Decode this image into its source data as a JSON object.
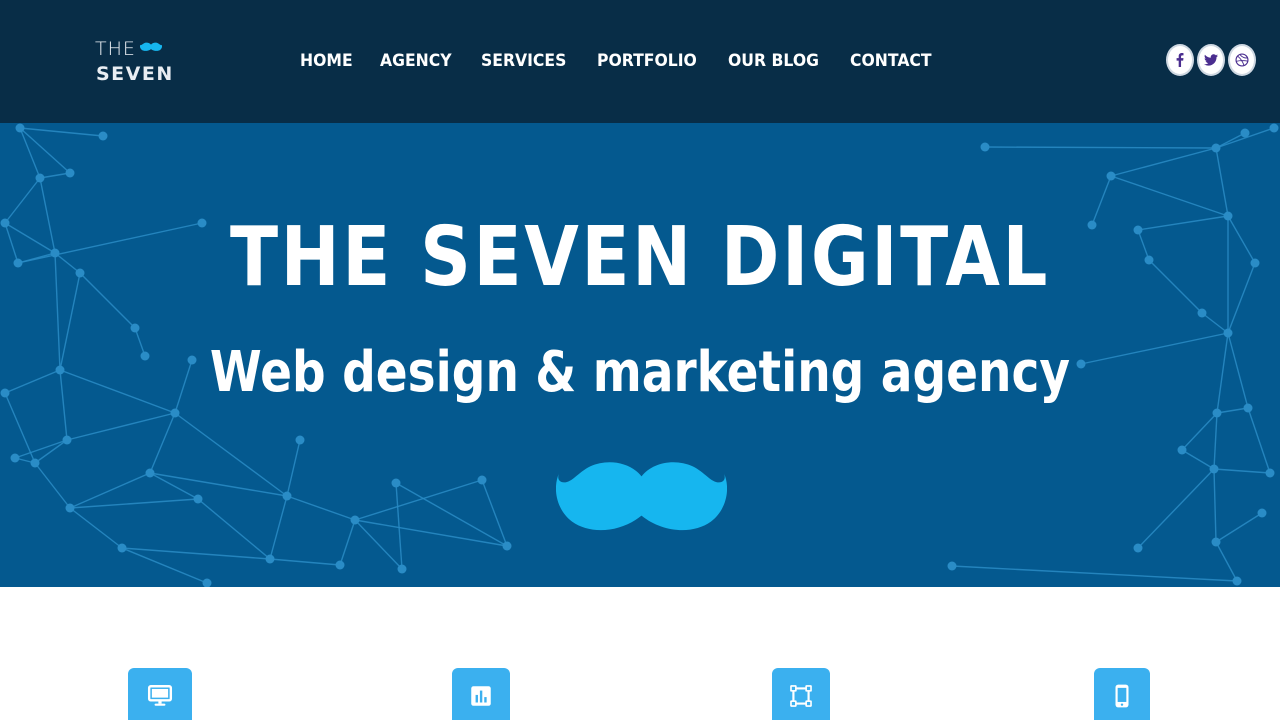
{
  "brand": {
    "line1": "THE",
    "line2": "SEVEN",
    "logo_icon": "mustache-icon"
  },
  "nav": {
    "items": [
      {
        "label": "HOME"
      },
      {
        "label": "AGENCY"
      },
      {
        "label": "SERVICES"
      },
      {
        "label": "PORTFOLIO"
      },
      {
        "label": "OUR BLOG"
      },
      {
        "label": "CONTACT"
      }
    ]
  },
  "social": {
    "icons": [
      "facebook-icon",
      "twitter-icon",
      "dribbble-icon"
    ]
  },
  "hero": {
    "title": "THE SEVEN DIGITAL",
    "subtitle": "Web design & marketing agency",
    "icon": "mustache-icon"
  },
  "features": {
    "icons": [
      "desktop-icon",
      "chart-icon",
      "vector-shape-icon",
      "mobile-icon"
    ]
  },
  "colors": {
    "header_bg": "#082d47",
    "hero_bg": "#04598f",
    "accent": "#3bb0ef",
    "mustache": "#16b6ef",
    "social_icon": "#4a2d8f"
  }
}
